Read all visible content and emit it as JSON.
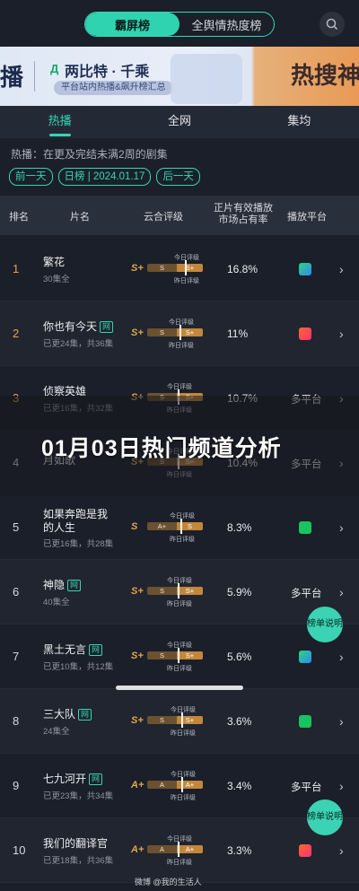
{
  "segment": {
    "tabs": [
      "霸屏榜",
      "全舆情热度榜"
    ],
    "active": 0
  },
  "banner": {
    "left_fragment": "播",
    "logo_mark": "Д",
    "brand": "两比特 · 千乘",
    "subtitle": "平台站内热播&飙升榜汇总",
    "right_text": "热搜神"
  },
  "tabs": [
    "热播",
    "全网",
    "集均"
  ],
  "description": "热播：在更及完结未满2周的剧集",
  "dates": {
    "prev": "前一天",
    "current": "日榜 | 2024.01.17",
    "next": "后一天"
  },
  "columns": {
    "rank": "排名",
    "name": "片名",
    "grade": "云合评级",
    "share": "正片有效播放市场占有率",
    "platform": "播放平台"
  },
  "grade_labels": {
    "today": "今日评级",
    "yesterday": "昨日评级"
  },
  "rows": [
    {
      "rank": "1",
      "name": "繁花",
      "badge": "",
      "meta": "30集全",
      "grade": "S+",
      "seg1": "S",
      "seg2": "S+",
      "marker": 0.68,
      "share": "16.8%",
      "platform": "",
      "platform_icon": "tencent-video-icon"
    },
    {
      "rank": "2",
      "name": "你也有今天",
      "badge": "网",
      "meta": "已更24集，共36集",
      "grade": "S+",
      "seg1": "S",
      "seg2": "S+",
      "marker": 0.58,
      "share": "11%",
      "platform": "",
      "platform_icon": "mango-tv-icon"
    },
    {
      "rank": "3",
      "name": "侦察英雄",
      "badge": "",
      "meta": "已更16集，共32集",
      "grade": "S+",
      "seg1": "S",
      "seg2": "S+",
      "marker": 0.55,
      "share": "10.7%",
      "platform": "多平台",
      "platform_icon": ""
    },
    {
      "rank": "4",
      "name": "月如歌",
      "badge": "",
      "meta": "",
      "grade": "S+",
      "seg1": "S",
      "seg2": "S+",
      "marker": 0.55,
      "share": "10.4%",
      "platform": "多平台",
      "platform_icon": ""
    },
    {
      "rank": "5",
      "name": "如果奔跑是我的人生",
      "badge": "",
      "meta": "已更16集，共28集",
      "grade": "S",
      "seg1": "A+",
      "seg2": "S",
      "marker": 0.6,
      "share": "8.3%",
      "platform": "",
      "platform_icon": "iqiyi-icon"
    },
    {
      "rank": "6",
      "name": "神隐",
      "badge": "网",
      "meta": "40集全",
      "grade": "S+",
      "seg1": "S",
      "seg2": "S+",
      "marker": 0.55,
      "share": "5.9%",
      "platform": "多平台",
      "platform_icon": ""
    },
    {
      "rank": "7",
      "name": "黑土无言",
      "badge": "网",
      "meta": "已更10集，共12集",
      "grade": "S+",
      "seg1": "S",
      "seg2": "S+",
      "marker": 0.55,
      "share": "5.6%",
      "platform": "",
      "platform_icon": "tencent-video-icon"
    },
    {
      "rank": "8",
      "name": "三大队",
      "badge": "网",
      "meta": "24集全",
      "grade": "S+",
      "seg1": "S",
      "seg2": "S+",
      "marker": 0.62,
      "share": "3.6%",
      "platform": "",
      "platform_icon": "iqiyi-icon"
    },
    {
      "rank": "9",
      "name": "七九河开",
      "badge": "网",
      "meta": "已更23集，共34集",
      "grade": "A+",
      "seg1": "A",
      "seg2": "A+",
      "marker": 0.62,
      "share": "3.4%",
      "platform": "多平台",
      "platform_icon": ""
    },
    {
      "rank": "10",
      "name": "我们的翻译官",
      "badge": "",
      "meta": "已更18集，共36集",
      "grade": "A+",
      "seg1": "A",
      "seg2": "A+",
      "marker": 0.55,
      "share": "3.3%",
      "platform": "",
      "platform_icon": "mango-tv-icon"
    }
  ],
  "overlay_title": "01月03日热门频道分析",
  "rule_button": "榜单说明",
  "watermark": "微博 @我的生活人"
}
